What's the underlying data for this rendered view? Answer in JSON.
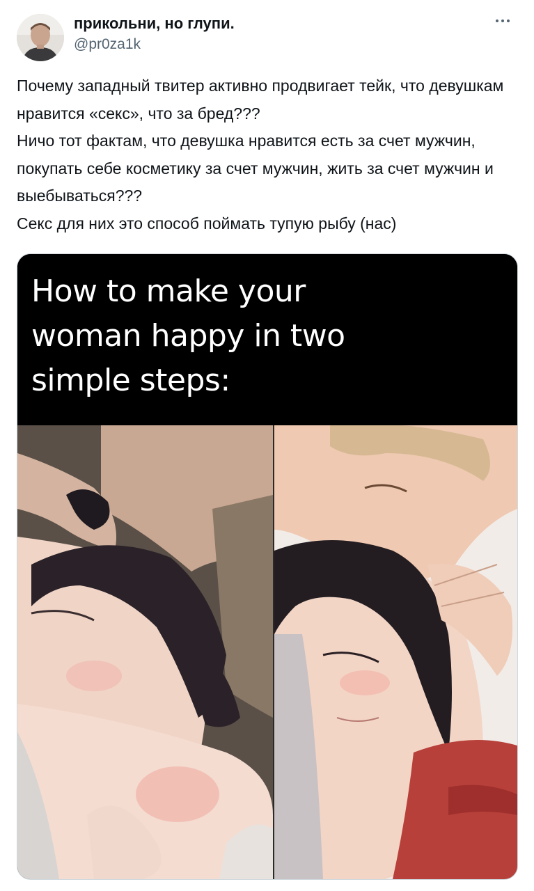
{
  "tweet": {
    "display_name": "прикольни, но глупи.",
    "handle": "@pr0za1k",
    "text_lines": [
      "Почему западный твитер активно продвигает тейк, что девушкам нравится «секс», что за бред???",
      "Ничо тот фактам, что девушка нравится есть за счет мужчин, покупать себе косметику за счет мужчин, жить за счет мужчин и выебываться???",
      "Секс для них это способ поймать тупую рыбу (нас)"
    ]
  },
  "media": {
    "caption_lines": [
      "How to make your",
      "woman happy in two",
      "simple steps:"
    ]
  }
}
